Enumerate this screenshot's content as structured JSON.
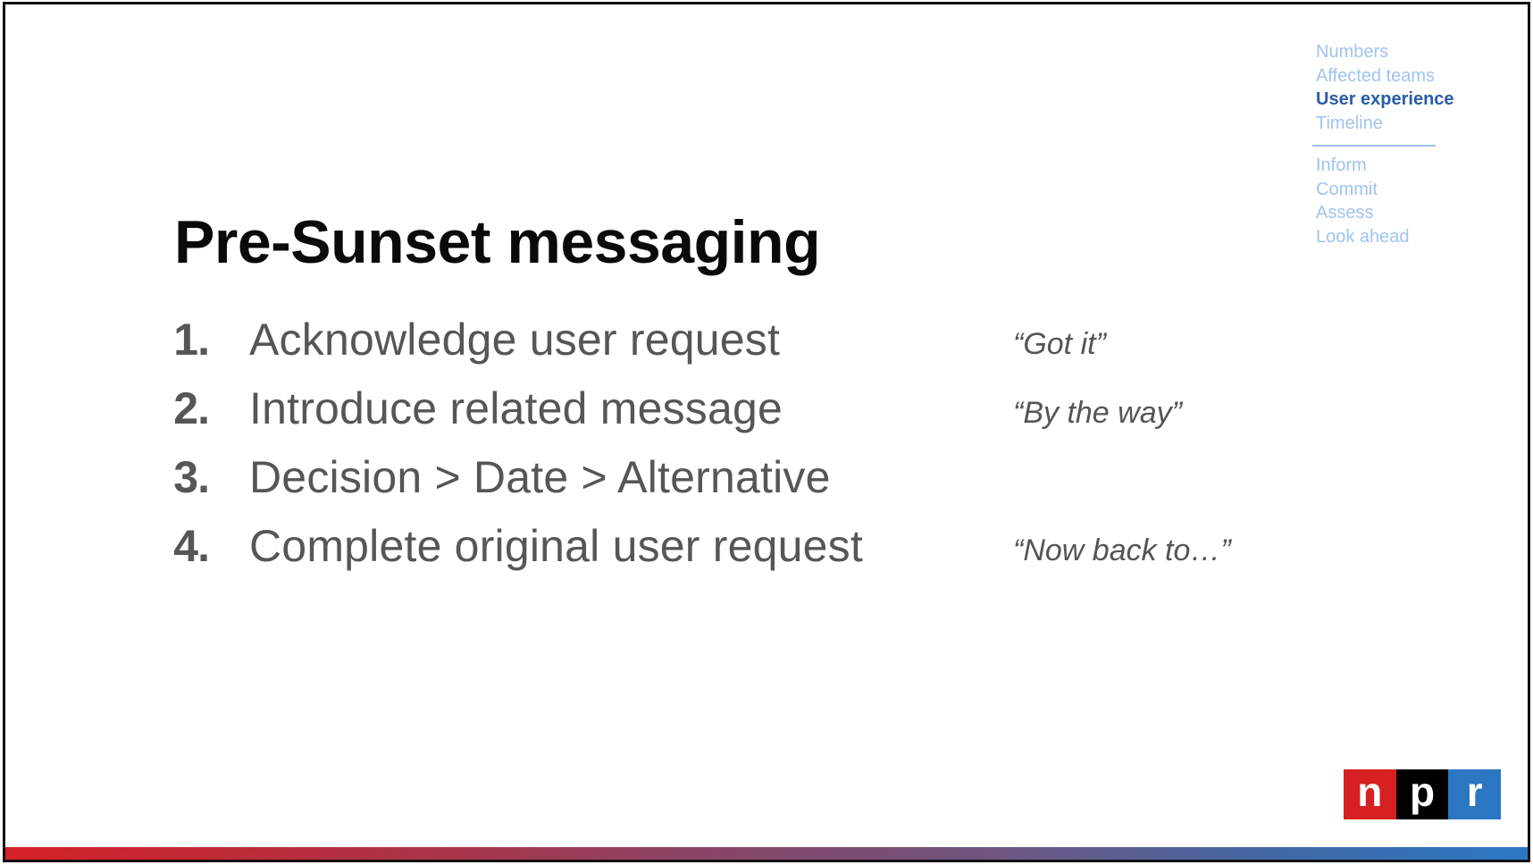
{
  "slide": {
    "title": "Pre-Sunset messaging",
    "items": [
      {
        "number": "1.",
        "text": "Acknowledge user request",
        "quote": "“Got it”"
      },
      {
        "number": "2.",
        "text": "Introduce related message",
        "quote": "“By the way”"
      },
      {
        "number": "3.",
        "text": "Decision > Date > Alternative",
        "quote": ""
      },
      {
        "number": "4.",
        "text": "Complete original user request",
        "quote": "“Now back to…”"
      }
    ]
  },
  "nav": {
    "sections": [
      {
        "label": "Numbers",
        "active": false
      },
      {
        "label": "Affected teams",
        "active": false
      },
      {
        "label": "User experience",
        "active": true
      },
      {
        "label": "Timeline",
        "active": false
      }
    ],
    "subsections": [
      {
        "label": "Inform"
      },
      {
        "label": "Commit"
      },
      {
        "label": "Assess"
      },
      {
        "label": "Look ahead"
      }
    ]
  },
  "logo": {
    "name": "npr-logo",
    "letters": [
      "n",
      "p",
      "r"
    ],
    "colors": [
      "#d62021",
      "#000000",
      "#2a76c0"
    ]
  },
  "theme": {
    "accent_active": "#2a5ca8",
    "accent_inactive": "#9fc3f0",
    "body_text": "#565656",
    "bar_gradient": [
      "#d42127",
      "#8a4465",
      "#2b78c4"
    ]
  }
}
